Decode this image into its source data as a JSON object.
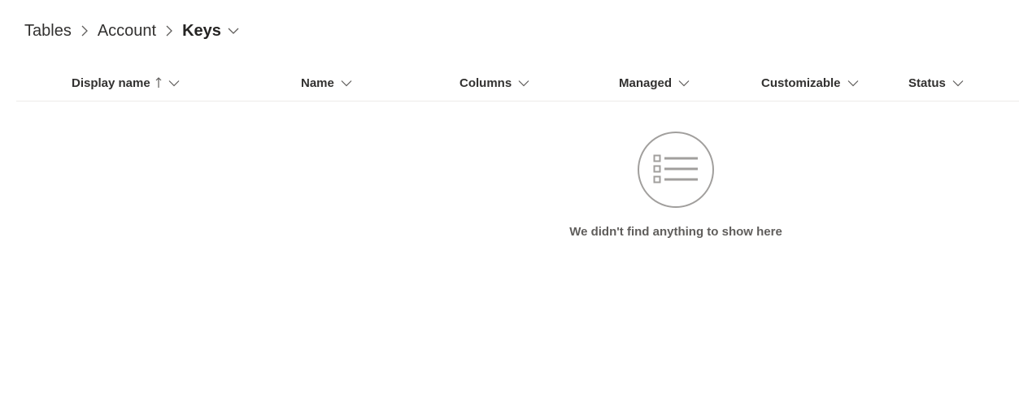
{
  "breadcrumb": {
    "items": [
      "Tables",
      "Account"
    ],
    "current": "Keys"
  },
  "columns": [
    {
      "label": "Display name",
      "sorted": "ascending"
    },
    {
      "label": "Name"
    },
    {
      "label": "Columns"
    },
    {
      "label": "Managed"
    },
    {
      "label": "Customizable"
    },
    {
      "label": "Status"
    }
  ],
  "empty_state": {
    "icon": "list-icon",
    "message": "We didn't find anything to show here"
  },
  "colors": {
    "text": "#323130",
    "muted": "#605e5c",
    "icon": "#a19f9d",
    "divider": "#edebe9"
  }
}
